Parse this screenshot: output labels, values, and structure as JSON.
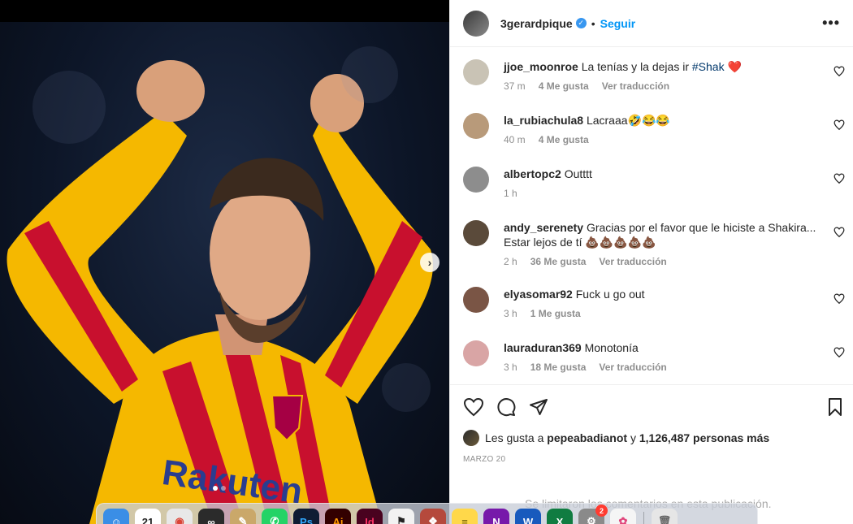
{
  "post": {
    "username": "3gerardpique",
    "follow_label": "Seguir",
    "separator": "•",
    "more_label": "•••",
    "verified_mark": "✓"
  },
  "comments": [
    {
      "user": "jjoe_moonroe",
      "text": "La tenías y la dejas ir",
      "tag": "#Shak",
      "emoji": "❤️",
      "time": "37 m",
      "likes": "4 Me gusta",
      "translate": "Ver traducción",
      "avatar_color": "#c9c3b5"
    },
    {
      "user": "la_rubiachula8",
      "text": "Lacraaa🤣😂😂",
      "tag": "",
      "emoji": "",
      "time": "40 m",
      "likes": "4 Me gusta",
      "translate": "",
      "avatar_color": "#b89a7a"
    },
    {
      "user": "albertopc2",
      "text": "Outttt",
      "tag": "",
      "emoji": "",
      "time": "1 h",
      "likes": "",
      "translate": "",
      "avatar_color": "#8d8d8d"
    },
    {
      "user": "andy_serenety",
      "text": "Gracias por el favor que le hiciste a Shakira... Estar lejos de tí 💩💩💩💩💩",
      "tag": "",
      "emoji": "",
      "time": "2 h",
      "likes": "36 Me gusta",
      "translate": "Ver traducción",
      "avatar_color": "#5a4a3a"
    },
    {
      "user": "elyasomar92",
      "text": "Fuck u go out",
      "tag": "",
      "emoji": "",
      "time": "3 h",
      "likes": "1 Me gusta",
      "translate": "",
      "avatar_color": "#7a5545"
    },
    {
      "user": "lauraduran369",
      "text": "Monotonía",
      "tag": "",
      "emoji": "",
      "time": "3 h",
      "likes": "18 Me gusta",
      "translate": "Ver traducción",
      "avatar_color": "#d9a5a5"
    }
  ],
  "likes_line": {
    "prefix": "Les gusta a",
    "user": "pepeabadianot",
    "connector": "y",
    "count": "1,126,487 personas más"
  },
  "date": "MARZO 20",
  "comments_limited": "Se limitaron los comentarios en esta publicación.",
  "carousel": {
    "next_icon": "›",
    "total_slides": 2,
    "active_slide": 1
  },
  "dock": {
    "apps": [
      {
        "name": "finder",
        "label": "☺",
        "color": "#3a8ee6"
      },
      {
        "name": "calendar",
        "label": "21",
        "color": "#ffffff",
        "text_color": "#222"
      },
      {
        "name": "chrome",
        "label": "◉",
        "color": "#e8e8e8",
        "text_color": "#db4437"
      },
      {
        "name": "creative-cloud",
        "label": "∞",
        "color": "#2b2b2b"
      },
      {
        "name": "pencil",
        "label": "✎",
        "color": "#caa86a"
      },
      {
        "name": "whatsapp",
        "label": "✆",
        "color": "#25d366"
      },
      {
        "name": "photoshop",
        "label": "Ps",
        "color": "#0f1c33",
        "text_color": "#31a8ff"
      },
      {
        "name": "illustrator",
        "label": "Ai",
        "color": "#330000",
        "text_color": "#ff9a00"
      },
      {
        "name": "indesign",
        "label": "Id",
        "color": "#49021f",
        "text_color": "#ff3366"
      },
      {
        "name": "runner-app",
        "label": "⚑",
        "color": "#f2f2f2",
        "text_color": "#222"
      },
      {
        "name": "book-app",
        "label": "❖",
        "color": "#b5493c"
      },
      {
        "name": "notes",
        "label": "≡",
        "color": "#ffd84a",
        "text_color": "#6b5a00"
      },
      {
        "name": "onenote",
        "label": "N",
        "color": "#7719aa"
      },
      {
        "name": "word",
        "label": "W",
        "color": "#185abd"
      },
      {
        "name": "excel",
        "label": "X",
        "color": "#107c41"
      },
      {
        "name": "system-preferences",
        "label": "⚙",
        "color": "#8a8a8a",
        "badge": "2"
      },
      {
        "name": "photos",
        "label": "✿",
        "color": "#f5f5f5",
        "text_color": "#e0457b"
      }
    ],
    "trash_label": "🗑"
  },
  "colors": {
    "accent": "#0095f6",
    "shirt_yellow": "#f5b800",
    "shirt_red": "#c8102e",
    "background_photo": "#0d1628"
  }
}
